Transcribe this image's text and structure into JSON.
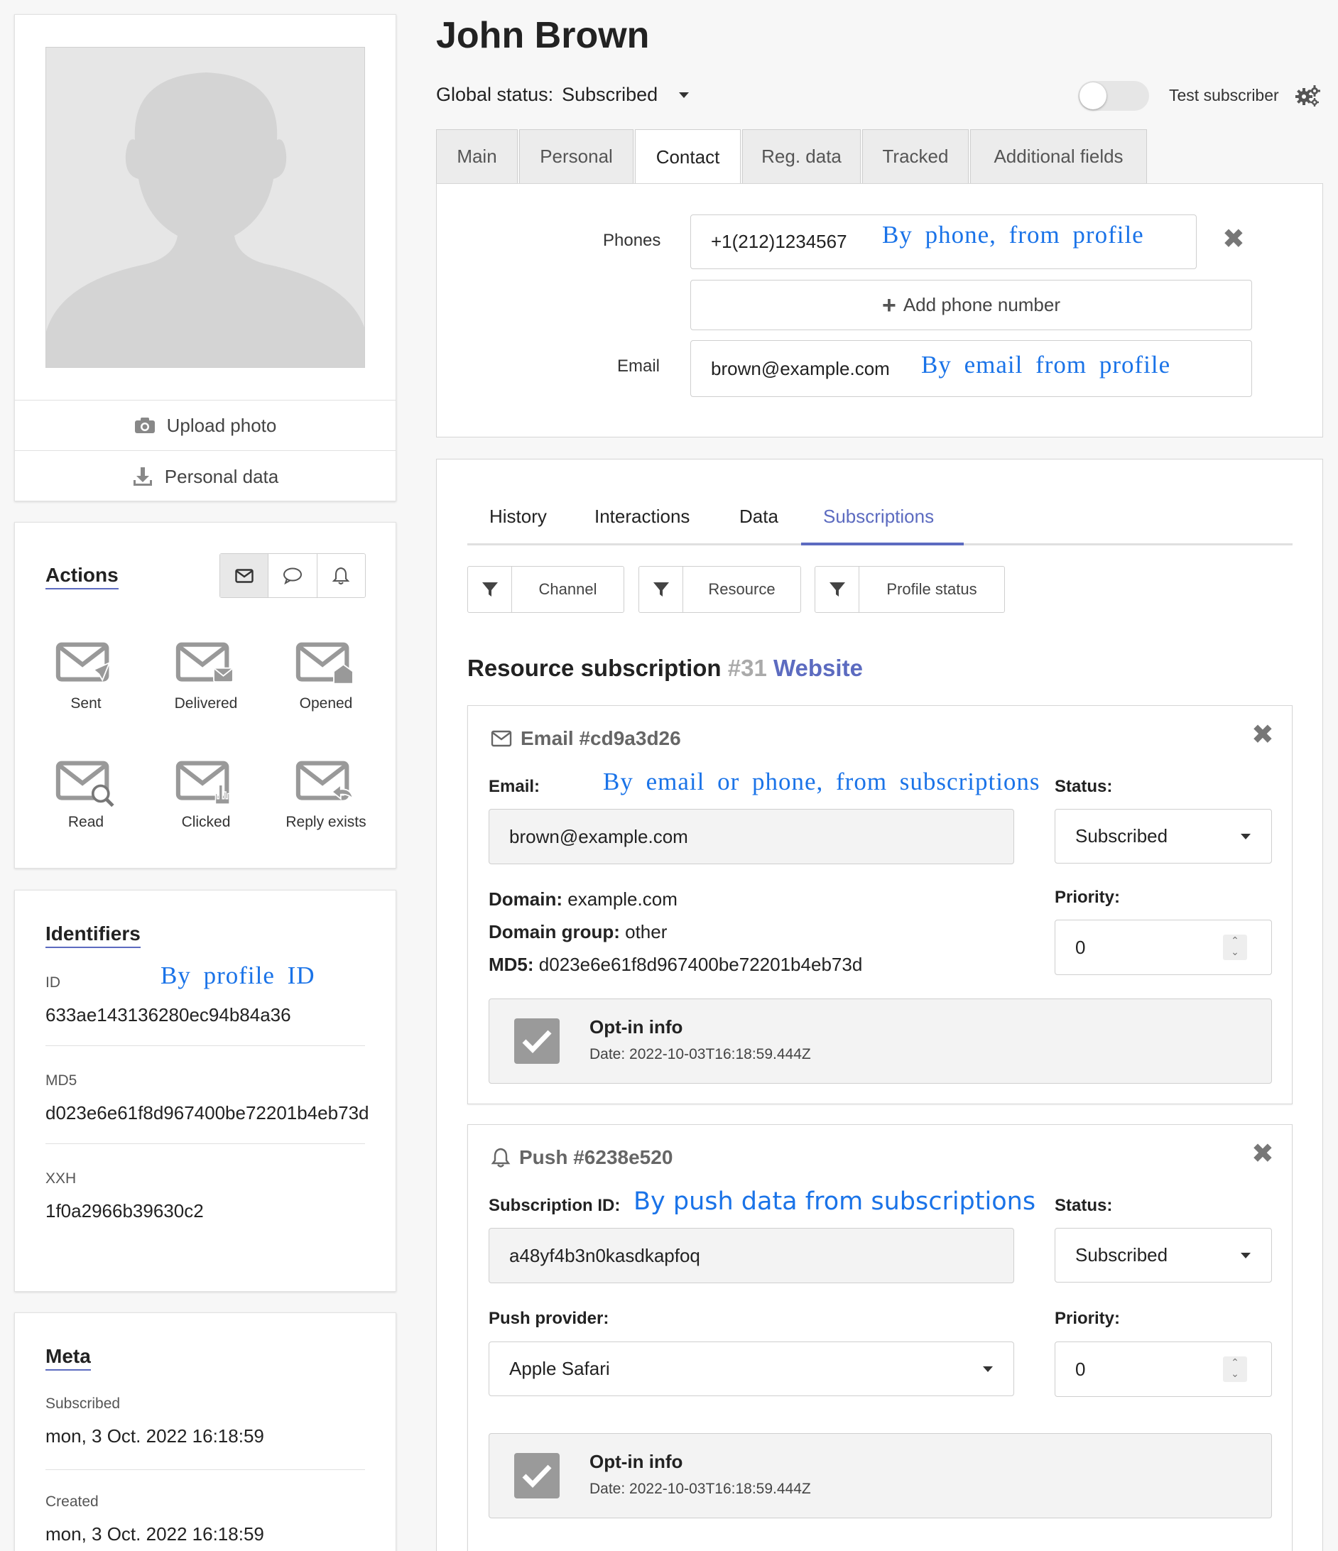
{
  "profile": {
    "name": "John Brown",
    "global_status_label": "Global status:",
    "global_status_value": "Subscribed",
    "test_subscriber_label": "Test subscriber",
    "test_subscriber_on": false
  },
  "left": {
    "upload_photo": "Upload photo",
    "personal_data": "Personal data",
    "actions": {
      "title": "Actions",
      "items": [
        {
          "label": "Sent",
          "icon": "envelope-sent-icon"
        },
        {
          "label": "Delivered",
          "icon": "envelope-delivered-icon"
        },
        {
          "label": "Opened",
          "icon": "envelope-opened-icon"
        },
        {
          "label": "Read",
          "icon": "envelope-read-icon"
        },
        {
          "label": "Clicked",
          "icon": "envelope-clicked-icon"
        },
        {
          "label": "Reply exists",
          "icon": "envelope-reply-icon"
        }
      ]
    },
    "identifiers": {
      "title": "Identifiers",
      "annotation": "By profile ID",
      "id_label": "ID",
      "id_value": "633ae143136280ec94b84a36",
      "md5_label": "MD5",
      "md5_value": "d023e6e61f8d967400be72201b4eb73d",
      "xxh_label": "XXH",
      "xxh_value": "1f0a2966b39630c2"
    },
    "meta": {
      "title": "Meta",
      "subscribed_label": "Subscribed",
      "subscribed_value": "mon, 3 Oct. 2022 16:18:59",
      "created_label": "Created",
      "created_value": "mon, 3 Oct. 2022 16:18:59"
    }
  },
  "tabs": [
    "Main",
    "Personal",
    "Contact",
    "Reg. data",
    "Tracked",
    "Additional fields"
  ],
  "contact": {
    "phones_label": "Phones",
    "phone_value": "+1(212)1234567",
    "phone_annotation": "By phone, from profile",
    "add_phone": "Add phone number",
    "email_label": "Email",
    "email_value": "brown@example.com",
    "email_annotation": "By email from profile"
  },
  "subtabs": [
    "History",
    "Interactions",
    "Data",
    "Subscriptions"
  ],
  "filters": [
    "Channel",
    "Resource",
    "Profile status"
  ],
  "resource": {
    "title": "Resource subscription",
    "id": "#31",
    "name": "Website"
  },
  "email_sub": {
    "header": "Email #cd9a3d26",
    "email_label": "Email:",
    "annotation": "By email or phone, from subscriptions",
    "email_value": "brown@example.com",
    "status_label": "Status:",
    "status_value": "Subscribed",
    "domain_label": "Domain:",
    "domain_value": "example.com",
    "group_label": "Domain group:",
    "group_value": "other",
    "md5_label": "MD5:",
    "md5_value": "d023e6e61f8d967400be72201b4eb73d",
    "priority_label": "Priority:",
    "priority_value": "0",
    "optin_title": "Opt-in info",
    "optin_date": "Date: 2022-10-03T16:18:59.444Z"
  },
  "push_sub": {
    "header": "Push #6238e520",
    "subid_label": "Subscription ID:",
    "annotation": "By push data from subscriptions",
    "subid_value": "a48yf4b3n0kasdkapfoq",
    "status_label": "Status:",
    "status_value": "Subscribed",
    "provider_label": "Push provider:",
    "provider_value": "Apple Safari",
    "priority_label": "Priority:",
    "priority_value": "0",
    "optin_title": "Opt-in info",
    "optin_date": "Date: 2022-10-03T16:18:59.444Z"
  },
  "colors": {
    "accent": "#5c6bc0",
    "annotation": "#1a73e8",
    "muted": "#9e9e9e"
  }
}
